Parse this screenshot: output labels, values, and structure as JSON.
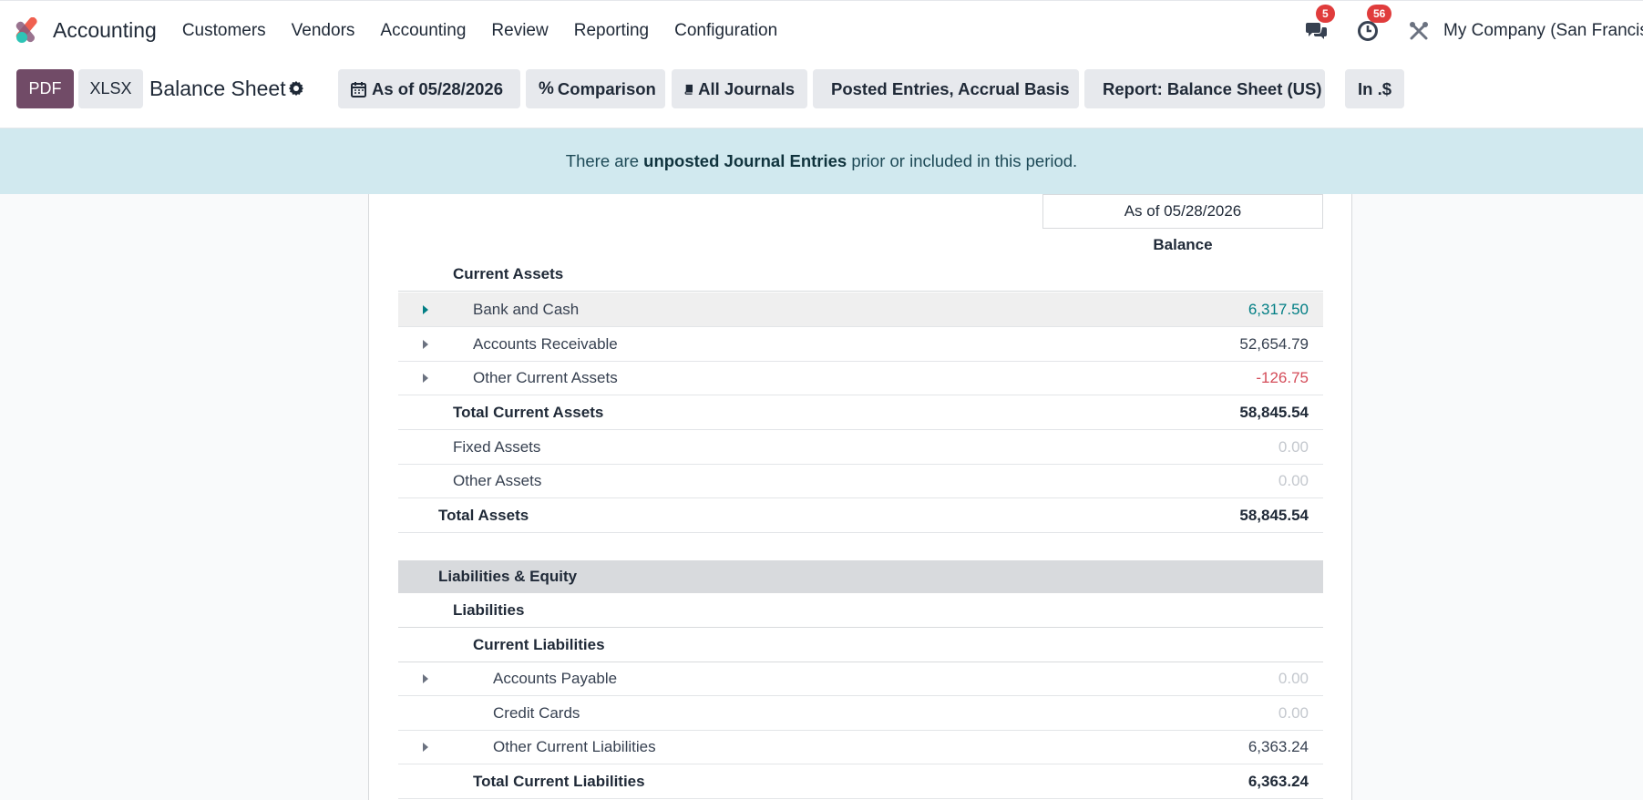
{
  "nav": {
    "app_name": "Accounting",
    "menu": [
      "Customers",
      "Vendors",
      "Accounting",
      "Review",
      "Reporting",
      "Configuration"
    ],
    "messages_count": "5",
    "activities_count": "56",
    "company": "My Company (San Francisco)"
  },
  "control": {
    "pdf_label": "PDF",
    "xlsx_label": "XLSX",
    "title": "Balance Sheet",
    "filters": {
      "date": "As of 05/28/2026",
      "comparison": "Comparison",
      "journals": "All Journals",
      "entries": "Posted Entries, Accrual Basis",
      "report": "Report: Balance Sheet (US)",
      "currency": "In .$"
    }
  },
  "alert": {
    "prefix": "There are ",
    "link": "unposted Journal Entries",
    "suffix": " prior or included in this period."
  },
  "report": {
    "column_header": "As of 05/28/2026",
    "column_sub": "Balance",
    "rows": {
      "current_assets": "Current Assets",
      "bank_cash": {
        "label": "Bank and Cash",
        "value": "6,317.50"
      },
      "receivable": {
        "label": "Accounts Receivable",
        "value": "52,654.79"
      },
      "other_current": {
        "label": "Other Current Assets",
        "value": "-126.75"
      },
      "total_current": {
        "label": "Total Current Assets",
        "value": "58,845.54"
      },
      "fixed": {
        "label": "Fixed Assets",
        "value": "0.00"
      },
      "other_assets": {
        "label": "Other Assets",
        "value": "0.00"
      },
      "total_assets": {
        "label": "Total Assets",
        "value": "58,845.54"
      },
      "liab_equity": "Liabilities & Equity",
      "liabilities": "Liabilities",
      "current_liabilities": "Current Liabilities",
      "payable": {
        "label": "Accounts Payable",
        "value": "0.00"
      },
      "credit_cards": {
        "label": "Credit Cards",
        "value": "0.00"
      },
      "other_current_liab": {
        "label": "Other Current Liabilities",
        "value": "6,363.24"
      },
      "total_current_liab": {
        "label": "Total Current Liabilities",
        "value": "6,363.24"
      }
    }
  },
  "colors": {
    "brand": "#714b67",
    "positive": "#017e84",
    "negative": "#d44c59",
    "alert_bg": "#d1e9ef"
  }
}
